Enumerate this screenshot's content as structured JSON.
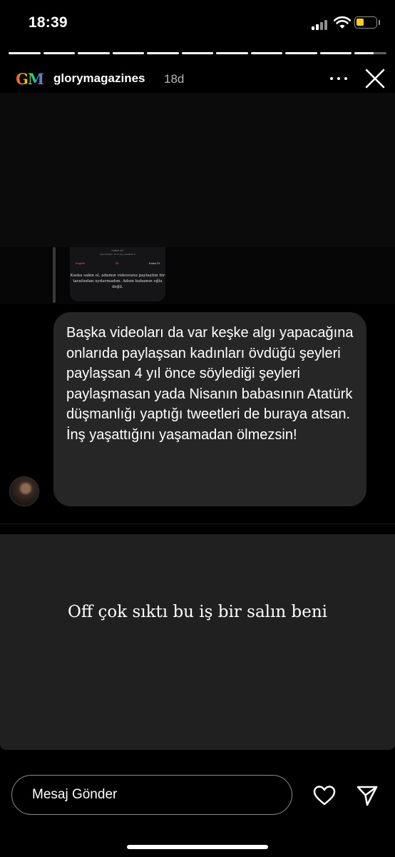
{
  "status_bar": {
    "time": "18:39",
    "signal_icon": "cellular-signal-icon",
    "wifi_icon": "wifi-icon",
    "battery_icon": "battery-icon",
    "battery_level": 0.4,
    "battery_color": "#f4cf29"
  },
  "story": {
    "progress_segments": [
      1,
      1,
      1,
      1,
      1,
      1,
      1,
      1,
      1,
      1,
      0.6
    ],
    "logo_text": "GM",
    "username": "glorymagazines",
    "age": "18d",
    "more_icon": "more-options-icon",
    "close_icon": "close-icon"
  },
  "thumbnail": {
    "small_heading": "Kaliteli mi?",
    "small_lines": "Kalbi ciddiyim, bu bir şey yazılabilir ve",
    "row_items": [
      "Engelle",
      "Sil",
      "Kabul Et"
    ],
    "quote": "Kaska sakin ol, adamın videosunu paylaştım bir tarafından uydurmadım. Adem babamın oğlu değil."
  },
  "message": {
    "text": "Başka videoları da var keşke algı yapacağına onlarıda paylaşsan kadınları övdüğü şeyleri paylaşsan 4 yıl önce söylediği şeyleri paylaşmasan yada Nisanın babasının Atatürk düşmanlığı yaptığı tweetleri de buraya atsan. İnş yaşattığını yaşamadan ölmezsin!"
  },
  "caption": {
    "text": "Off çok sıktı bu iş bir salın beni"
  },
  "reply": {
    "placeholder": "Mesaj Gönder",
    "heart_icon": "heart-icon",
    "send_icon": "send-icon"
  }
}
